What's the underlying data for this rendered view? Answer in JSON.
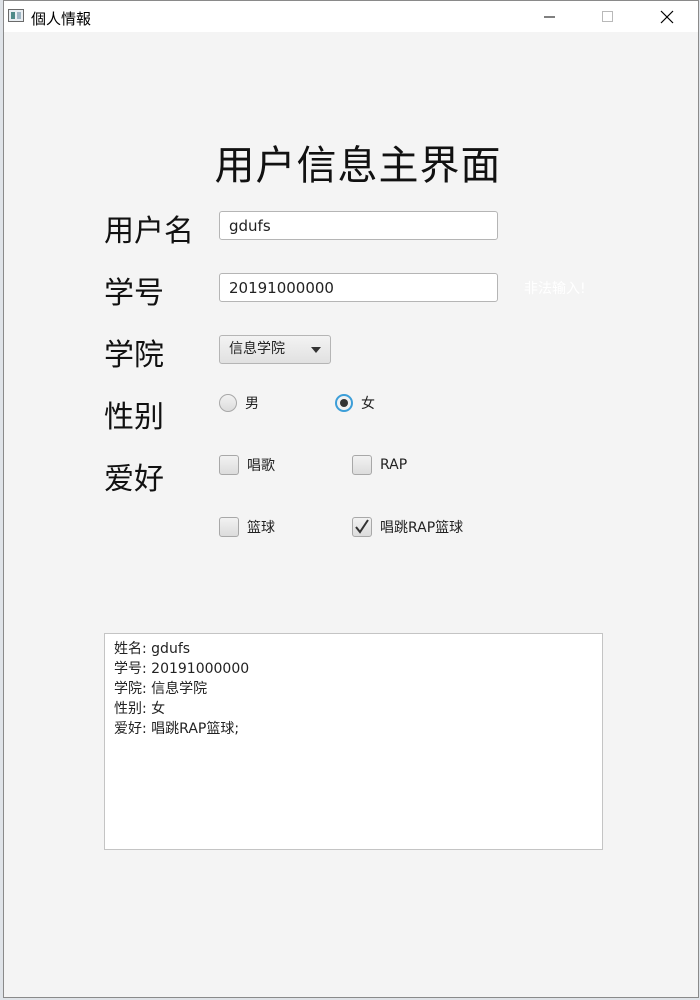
{
  "window": {
    "title": "個人情報"
  },
  "form": {
    "title": "用户信息主界面",
    "username": {
      "label": "用户名",
      "value": "gdufs"
    },
    "student_id": {
      "label": "学号",
      "value": "20191000000",
      "error": "非法输入!"
    },
    "college": {
      "label": "学院",
      "selected": "信息学院"
    },
    "gender": {
      "label": "性别",
      "options": [
        {
          "label": "男",
          "selected": false
        },
        {
          "label": "女",
          "selected": true
        }
      ]
    },
    "hobbies": {
      "label": "爱好",
      "options": [
        {
          "label": "唱歌",
          "checked": false
        },
        {
          "label": "RAP",
          "checked": false
        },
        {
          "label": "篮球",
          "checked": false
        },
        {
          "label": "唱跳RAP篮球",
          "checked": true
        }
      ]
    }
  },
  "result": {
    "lines": [
      "姓名: gdufs",
      "学号: 20191000000",
      "学院: 信息学院",
      "性别: 女",
      "爱好: 唱跳RAP篮球;"
    ]
  },
  "colors": {
    "accent": "#3c9ed8",
    "window_bg": "#f4f4f4",
    "error_text": "#ffffff"
  }
}
